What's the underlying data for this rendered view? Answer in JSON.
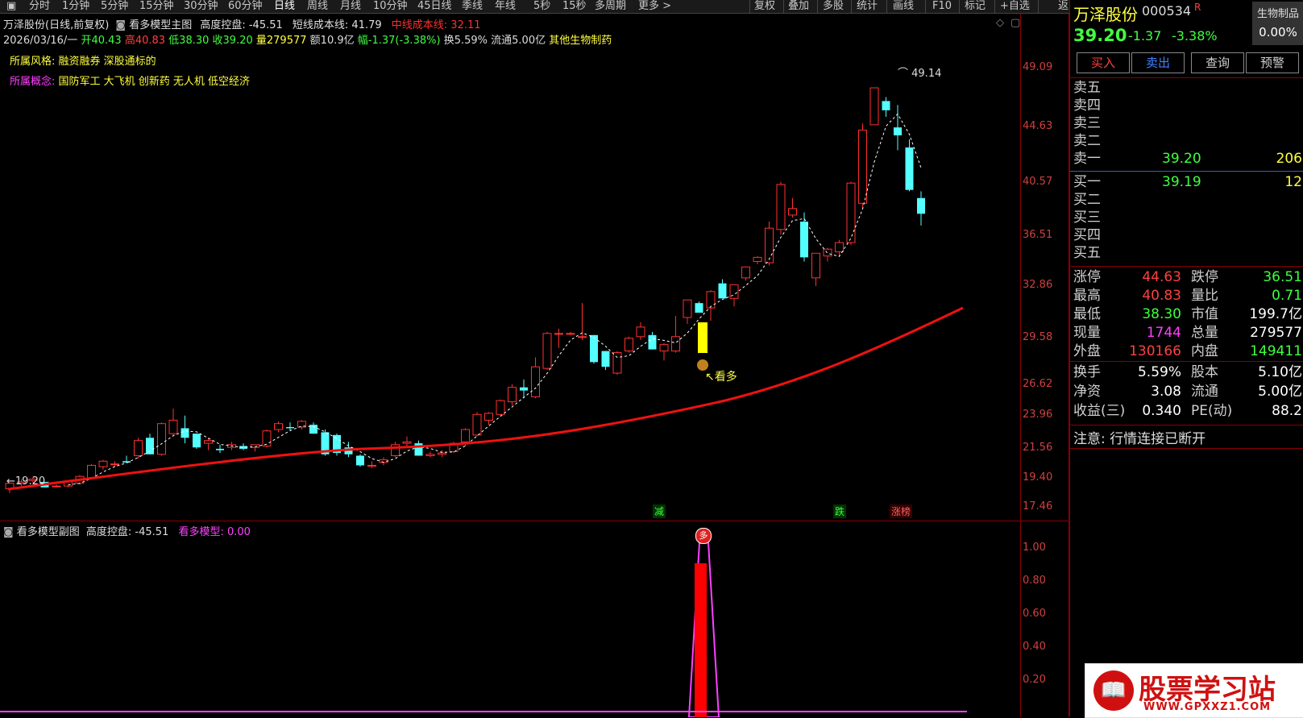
{
  "toolbar": {
    "items": [
      "分时",
      "1分钟",
      "5分钟",
      "15分钟",
      "30分钟",
      "60分钟",
      "日线",
      "周线",
      "月线",
      "10分钟",
      "45日线",
      "季线",
      "年线",
      "5秒",
      "15秒",
      "多周期",
      "更多 >"
    ],
    "right": [
      "复权",
      "叠加",
      "多股",
      "统计",
      "画线",
      "F10",
      "标记",
      "+自选",
      "返回"
    ]
  },
  "main": {
    "title": "万泽股份(日线,前复权)",
    "indicator": "看多模型主图",
    "height_label": "高度控盘: -45.51",
    "short_line": "短线成本线: 41.79",
    "mid_line": "中线成本线: 32.11",
    "date": "2026/03/16/一",
    "open": "开40.43",
    "high": "高40.83",
    "low": "低38.30",
    "close": "收39.20",
    "vol": "量279577",
    "amt": "额10.9亿",
    "chg": "幅-1.37(-3.38%)",
    "turn": "换5.59%",
    "float": "流通5.00亿",
    "sector": "其他生物制药",
    "style_label": "所属风格:",
    "style_val": "融资融券 深股通标的",
    "concept_label": "所属概念:",
    "concept_val": "国防军工 大飞机 创新药 无人机 低空经济",
    "max_label": "49.14",
    "min_label": "19.20",
    "signal": "看多",
    "marks": [
      "减",
      "跌",
      "涨榜"
    ],
    "yticks": [
      "49.09",
      "44.63",
      "40.57",
      "36.51",
      "32.86",
      "29.58",
      "26.62",
      "23.96",
      "21.56",
      "19.40",
      "17.46"
    ]
  },
  "sub": {
    "title": "看多模型副图",
    "height_label": "高度控盘: -45.51",
    "model_label": "看多模型: 0.00",
    "yticks": [
      "1.00",
      "0.80",
      "0.60",
      "0.40",
      "0.20"
    ],
    "marker": "多"
  },
  "panel": {
    "name": "万泽股份",
    "code": "000534",
    "r": "R",
    "sector_btn": "生物制品",
    "pct_box": "0.00%",
    "price": "39.20",
    "chg": "-1.37",
    "chg_pct": "-3.38%",
    "buttons": [
      "买入",
      "卖出",
      "查询",
      "预警"
    ],
    "sells": [
      {
        "l": "卖五",
        "p": "",
        "v": ""
      },
      {
        "l": "卖四",
        "p": "",
        "v": ""
      },
      {
        "l": "卖三",
        "p": "",
        "v": ""
      },
      {
        "l": "卖二",
        "p": "",
        "v": ""
      },
      {
        "l": "卖一",
        "p": "39.20",
        "v": "206"
      }
    ],
    "buys": [
      {
        "l": "买一",
        "p": "39.19",
        "v": "12"
      },
      {
        "l": "买二",
        "p": "",
        "v": ""
      },
      {
        "l": "买三",
        "p": "",
        "v": ""
      },
      {
        "l": "买四",
        "p": "",
        "v": ""
      },
      {
        "l": "买五",
        "p": "",
        "v": ""
      }
    ],
    "stats": [
      {
        "l": "涨停",
        "v": "44.63",
        "c": "red",
        "l2": "跌停",
        "v2": "36.51",
        "c2": "green"
      },
      {
        "l": "最高",
        "v": "40.83",
        "c": "red",
        "l2": "量比",
        "v2": "0.71",
        "c2": "green"
      },
      {
        "l": "最低",
        "v": "38.30",
        "c": "green",
        "l2": "市值",
        "v2": "199.7亿",
        "c2": "white"
      },
      {
        "l": "现量",
        "v": "1744",
        "c": "purple",
        "l2": "总量",
        "v2": "279577",
        "c2": "white"
      },
      {
        "l": "外盘",
        "v": "130166",
        "c": "red",
        "l2": "内盘",
        "v2": "149411",
        "c2": "green"
      }
    ],
    "stats2": [
      {
        "l": "换手",
        "v": "5.59%",
        "l2": "股本",
        "v2": "5.10亿"
      },
      {
        "l": "净资",
        "v": "3.08",
        "l2": "流通",
        "v2": "5.00亿"
      },
      {
        "l": "收益(三)",
        "v": "0.340",
        "l2": "PE(动)",
        "v2": "88.2"
      }
    ],
    "notice": "注意: 行情连接已断开"
  },
  "watermark": {
    "text": "股票学习站",
    "url": "WWW.GPXXZ1.COM"
  },
  "chart_data": {
    "type": "candlestick",
    "ylim": [
      17.46,
      49.09
    ],
    "candles": [
      [
        19.6,
        20.0,
        19.3,
        20.0
      ],
      [
        20.0,
        20.3,
        19.8,
        20.1
      ],
      [
        20.2,
        20.4,
        20.0,
        20.3
      ],
      [
        20.1,
        20.0,
        19.7,
        19.7
      ],
      [
        19.8,
        19.9,
        19.7,
        19.8
      ],
      [
        19.8,
        20.2,
        19.7,
        20.1
      ],
      [
        20.0,
        20.6,
        19.9,
        20.5
      ],
      [
        20.4,
        21.4,
        20.3,
        21.3
      ],
      [
        21.2,
        21.7,
        21.0,
        21.6
      ],
      [
        21.4,
        21.6,
        21.2,
        21.4
      ],
      [
        21.6,
        22.0,
        21.5,
        21.5
      ],
      [
        22.0,
        23.3,
        21.8,
        23.1
      ],
      [
        23.3,
        23.6,
        22.2,
        22.1
      ],
      [
        22.1,
        24.5,
        22.0,
        24.4
      ],
      [
        23.6,
        25.7,
        23.5,
        24.7
      ],
      [
        24.0,
        25.1,
        22.9,
        23.3
      ],
      [
        23.6,
        23.6,
        22.5,
        22.6
      ],
      [
        22.9,
        23.3,
        22.4,
        23.1
      ],
      [
        22.5,
        22.8,
        22.2,
        22.4
      ],
      [
        22.6,
        23.0,
        22.4,
        22.8
      ],
      [
        22.7,
        22.9,
        22.4,
        22.5
      ],
      [
        22.6,
        22.8,
        22.3,
        22.8
      ],
      [
        22.7,
        23.9,
        22.6,
        23.8
      ],
      [
        23.9,
        24.6,
        23.7,
        24.4
      ],
      [
        24.1,
        24.5,
        23.8,
        24.0
      ],
      [
        24.1,
        24.7,
        23.9,
        24.6
      ],
      [
        24.3,
        24.5,
        23.6,
        23.6
      ],
      [
        23.7,
        23.9,
        22.0,
        22.1
      ],
      [
        23.5,
        23.6,
        22.0,
        22.2
      ],
      [
        22.6,
        23.0,
        21.9,
        22.1
      ],
      [
        22.0,
        22.1,
        21.2,
        21.3
      ],
      [
        21.3,
        21.6,
        21.1,
        21.3
      ],
      [
        21.5,
        21.9,
        21.3,
        21.7
      ],
      [
        22.0,
        23.0,
        21.9,
        22.8
      ],
      [
        22.9,
        23.4,
        22.7,
        23.0
      ],
      [
        22.9,
        23.1,
        22.0,
        22.0
      ],
      [
        22.0,
        22.3,
        21.9,
        22.1
      ],
      [
        22.1,
        22.4,
        21.9,
        22.2
      ],
      [
        22.3,
        23.0,
        22.2,
        22.9
      ],
      [
        23.0,
        24.0,
        22.7,
        23.9
      ],
      [
        23.5,
        25.4,
        23.4,
        25.2
      ],
      [
        24.7,
        25.4,
        24.3,
        25.3
      ],
      [
        25.2,
        26.5,
        25.1,
        26.4
      ],
      [
        26.3,
        27.5,
        26.0,
        27.3
      ],
      [
        27.3,
        27.8,
        26.6,
        27.1
      ],
      [
        26.7,
        29.2,
        26.6,
        28.6
      ],
      [
        28.5,
        30.8,
        28.4,
        30.7
      ],
      [
        30.7,
        31.0,
        29.8,
        30.7
      ],
      [
        30.7,
        30.8,
        30.6,
        30.7
      ],
      [
        30.5,
        32.6,
        30.3,
        30.5
      ],
      [
        30.6,
        30.4,
        28.8,
        28.9
      ],
      [
        29.6,
        29.6,
        28.4,
        28.6
      ],
      [
        28.2,
        29.6,
        28.1,
        29.5
      ],
      [
        29.6,
        30.5,
        29.5,
        30.4
      ],
      [
        30.5,
        31.4,
        30.3,
        31.1
      ],
      [
        30.6,
        30.8,
        30.1,
        29.7
      ],
      [
        29.6,
        30.1,
        29.0,
        30.0
      ],
      [
        29.6,
        31.8,
        29.5,
        30.5
      ],
      [
        31.7,
        32.8,
        31.3,
        32.8
      ],
      [
        32.6,
        32.7,
        32.0,
        32.0
      ],
      [
        32.3,
        33.5,
        31.5,
        33.4
      ],
      [
        34.0,
        34.3,
        33.2,
        32.9
      ],
      [
        32.9,
        33.8,
        32.4,
        33.9
      ],
      [
        34.4,
        35.0,
        34.2,
        35.2
      ],
      [
        35.6,
        36.0,
        35.4,
        35.9
      ],
      [
        35.5,
        38.6,
        35.3,
        38.1
      ],
      [
        38.0,
        41.6,
        37.6,
        41.4
      ],
      [
        39.1,
        40.4,
        38.9,
        39.6
      ],
      [
        38.6,
        39.3,
        35.6,
        35.9
      ],
      [
        34.4,
        36.0,
        33.8,
        36.2
      ],
      [
        36.0,
        36.6,
        35.6,
        36.5
      ],
      [
        36.3,
        37.2,
        36.0,
        37.0
      ],
      [
        37.0,
        41.6,
        36.8,
        41.5
      ],
      [
        40.0,
        45.9,
        39.7,
        45.4
      ],
      [
        45.8,
        48.4,
        46.0,
        48.6
      ],
      [
        47.6,
        47.9,
        46.4,
        46.9
      ],
      [
        45.6,
        47.3,
        43.9,
        45.0
      ],
      [
        44.1,
        44.7,
        40.9,
        41.0
      ],
      [
        40.4,
        40.9,
        38.3,
        39.2
      ]
    ]
  }
}
